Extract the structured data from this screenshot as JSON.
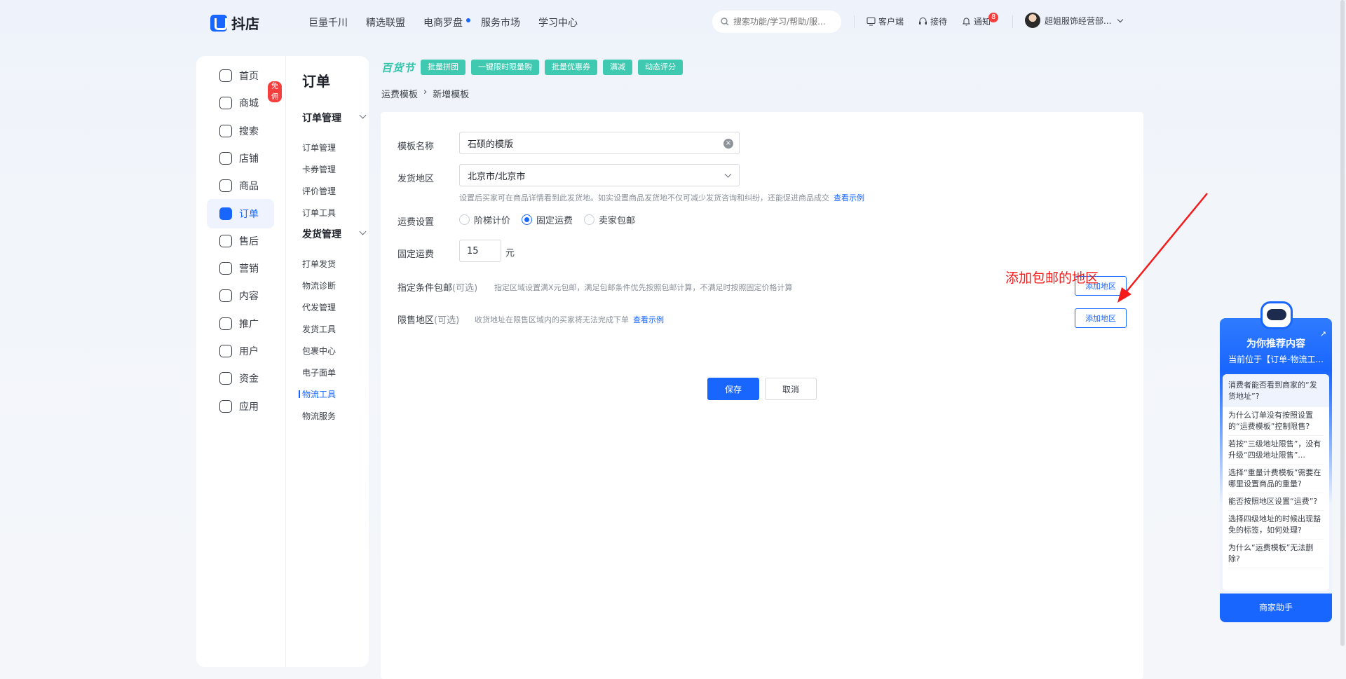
{
  "header": {
    "logo_text": "抖店",
    "nav": [
      "巨量千川",
      "精选联盟",
      "电商罗盘",
      "服务市场",
      "学习中心"
    ],
    "search_placeholder": "搜索功能/学习/帮助/服...",
    "client_label": "客户端",
    "reception_label": "接待",
    "notify_label": "通知",
    "notify_count": "8",
    "user_name": "超姐服饰经营部..."
  },
  "main_nav": {
    "items": [
      {
        "label": "首页",
        "icon": "home-icon"
      },
      {
        "label": "商城",
        "icon": "mall-icon",
        "badge": "免佣"
      },
      {
        "label": "搜索",
        "icon": "search-icon"
      },
      {
        "label": "店铺",
        "icon": "shop-icon"
      },
      {
        "label": "商品",
        "icon": "product-icon"
      },
      {
        "label": "订单",
        "icon": "order-icon",
        "active": true
      },
      {
        "label": "售后",
        "icon": "after-sale-icon"
      },
      {
        "label": "营销",
        "icon": "marketing-icon"
      },
      {
        "label": "内容",
        "icon": "content-icon"
      },
      {
        "label": "推广",
        "icon": "promote-icon"
      },
      {
        "label": "用户",
        "icon": "user-icon"
      },
      {
        "label": "资金",
        "icon": "funds-icon"
      },
      {
        "label": "应用",
        "icon": "app-icon"
      }
    ]
  },
  "sub_nav": {
    "title": "订单",
    "group1": {
      "label": "订单管理",
      "items": [
        "订单管理",
        "卡券管理",
        "评价管理",
        "订单工具"
      ]
    },
    "group2": {
      "label": "发货管理",
      "items": [
        "打单发货",
        "物流诊断",
        "代发管理",
        "发货工具",
        "包裹中心",
        "电子面单",
        "物流工具",
        "物流服务"
      ]
    }
  },
  "tag_strip": {
    "logo": "百货节",
    "tags": [
      "批量拼团",
      "一键限时限量购",
      "批量优惠券",
      "满减",
      "动态评分"
    ]
  },
  "breadcrumb": {
    "parent": "运费模板",
    "current": "新增模板"
  },
  "form": {
    "template_name_label": "模板名称",
    "template_name_value": "石硕的模版",
    "ship_region_label": "发货地区",
    "ship_region_value": "北京市/北京市",
    "ship_region_hint": "设置后买家可在商品详情看到此发货地。如实设置商品发货地不仅可减少发货咨询和纠纷，还能促进商品成交",
    "view_example": "查看示例",
    "fee_setting_label": "运费设置",
    "fee_options": [
      "阶梯计价",
      "固定运费",
      "卖家包邮"
    ],
    "fee_selected": "固定运费",
    "fixed_fee_label": "固定运费",
    "fixed_fee_value": "15",
    "fixed_fee_unit": "元",
    "free_ship_label": "指定条件包邮",
    "optional": "(可选)",
    "free_ship_hint": "指定区域设置满X元包邮，满足包邮条件优先按照包邮计算，不满足时按照固定价格计算",
    "add_region_button": "添加地区",
    "restrict_label": "限售地区",
    "restrict_hint": "收货地址在限售区域内的买家将无法完成下单",
    "save_button": "保存",
    "cancel_button": "取消"
  },
  "annotation": {
    "text": "添加包邮的地区",
    "color": "#f51b1b"
  },
  "assistant": {
    "title": "为你推荐内容",
    "subtitle": "当前位于【订单-物流工...",
    "questions": [
      "消费者能否看到商家的“发货地址”?",
      "为什么订单没有按照设置的“运费模板”控制限售?",
      "若按“三级地址限售”，没有升级“四级地址限售”...",
      "选择“重量计费模板”需要在哪里设置商品的重量?",
      "能否按照地区设置“运费”?",
      "选择四级地址的时候出现豁免的标签，如何处理?",
      "为什么“运费模板”无法删除?"
    ],
    "button": "商家助手"
  },
  "colors": {
    "brand": "#1966ff",
    "accent_tag": "#3fc9b0",
    "danger": "#f53f3f"
  }
}
